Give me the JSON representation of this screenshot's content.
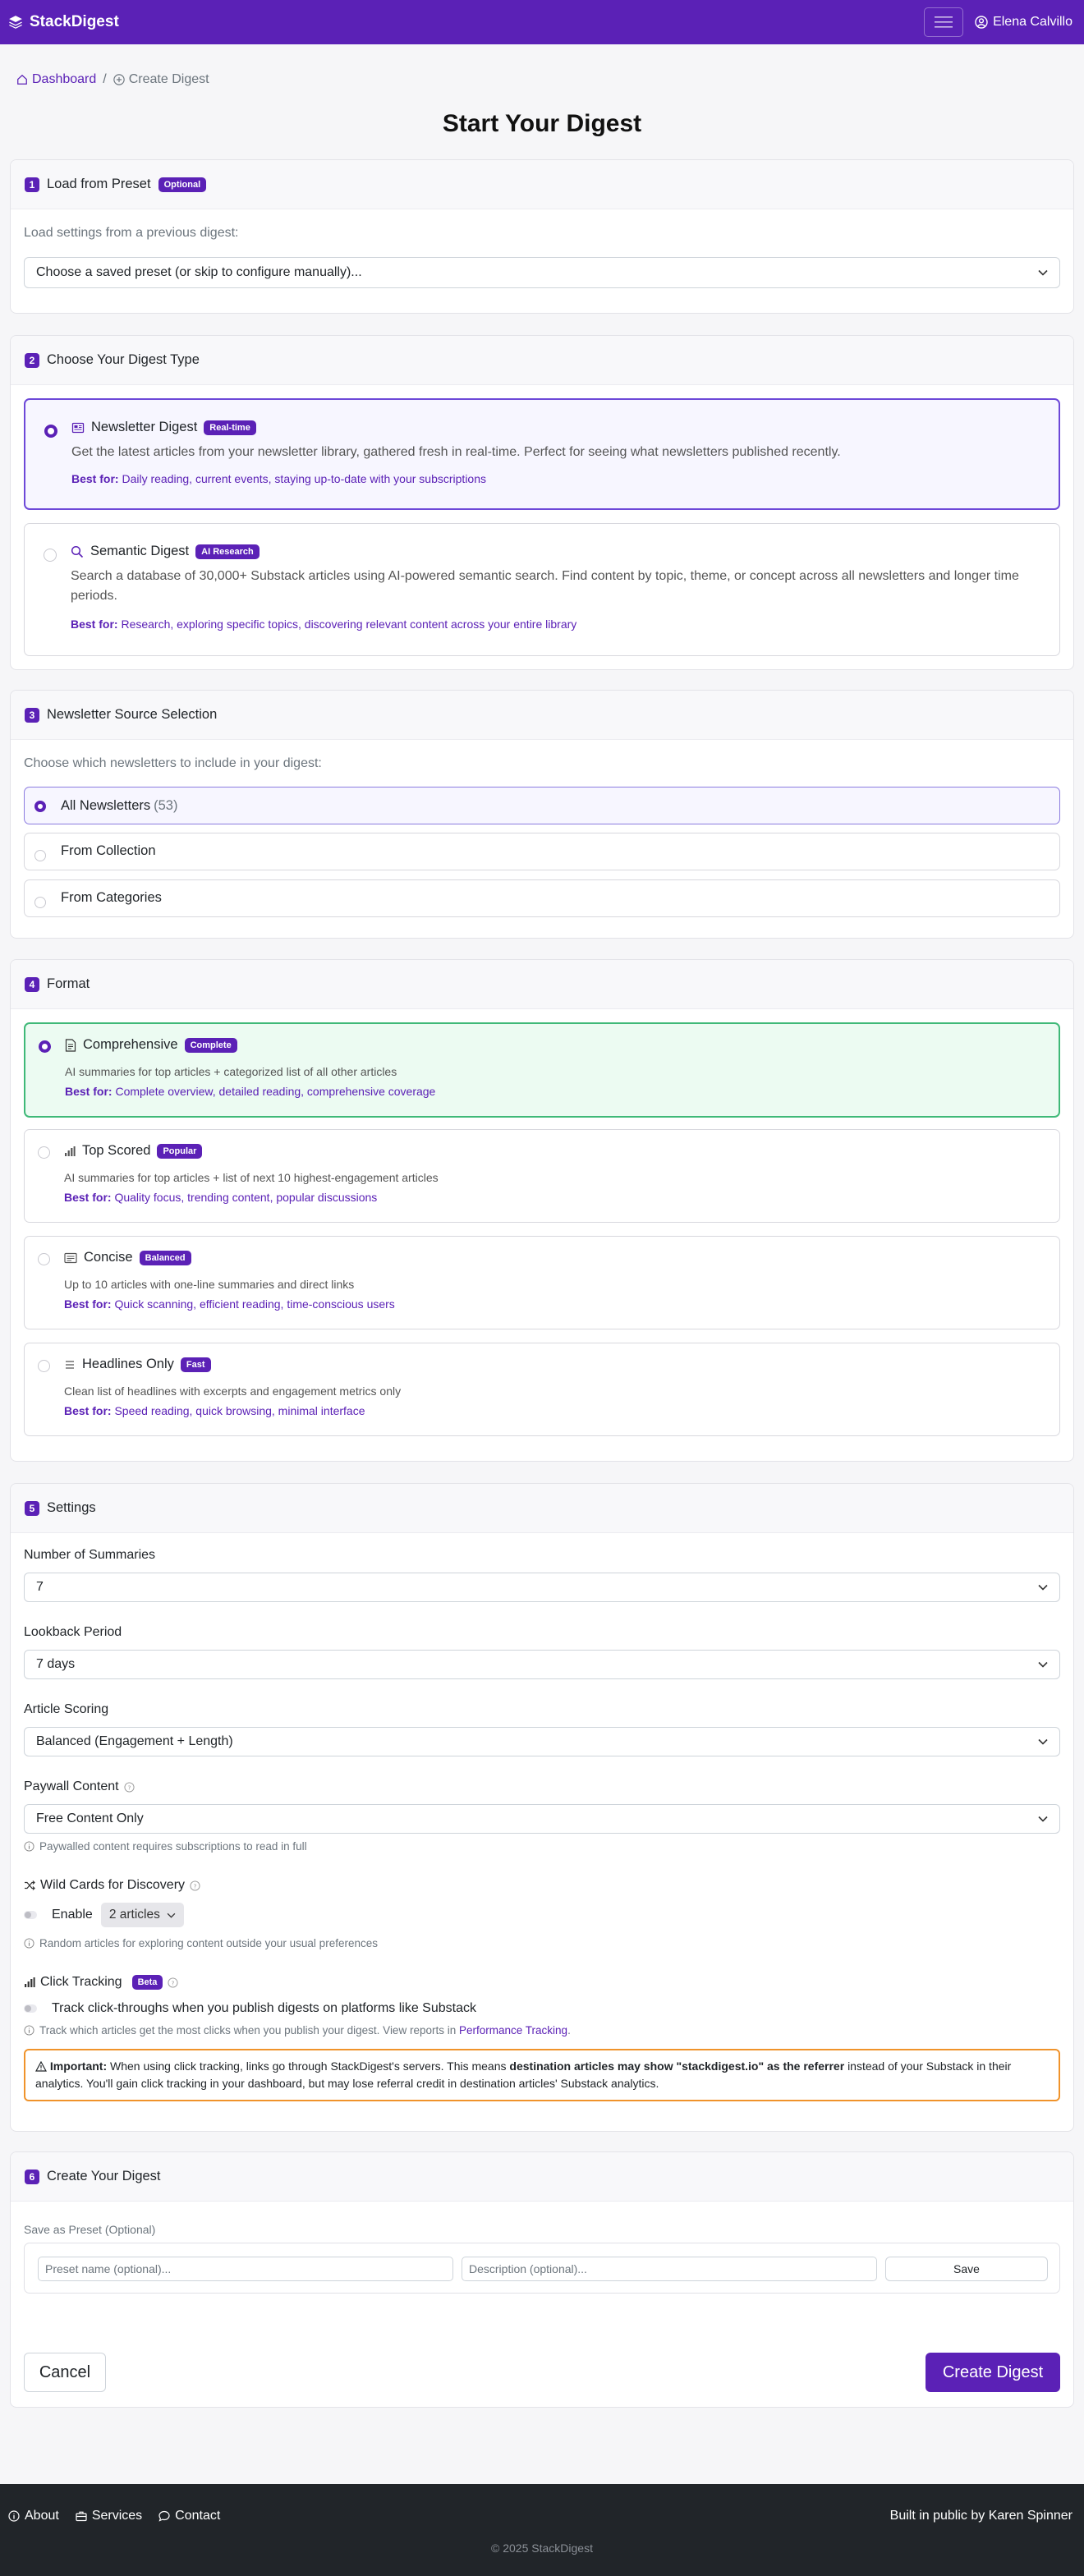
{
  "nav": {
    "brand": "StackDigest",
    "user": "Elena Calvillo"
  },
  "breadcrumb": {
    "home": "Dashboard",
    "separator": "/",
    "current": "Create Digest"
  },
  "page_title": "Start Your Digest",
  "s1": {
    "num": "1",
    "title": "Load from Preset",
    "badge": "Optional",
    "label": "Load settings from a previous digest:",
    "select": "Choose a saved preset (or skip to configure manually)..."
  },
  "s2": {
    "num": "2",
    "title": "Choose Your Digest Type",
    "types": [
      {
        "title": "Newsletter Digest",
        "badge": "Real-time",
        "desc": "Get the latest articles from your newsletter library, gathered fresh in real-time. Perfect for seeing what newsletters published recently.",
        "best_label": "Best for:",
        "best": "Daily reading, current events, staying up-to-date with your subscriptions"
      },
      {
        "title": "Semantic Digest",
        "badge": "AI Research",
        "desc": "Search a database of 30,000+ Substack articles using AI-powered semantic search. Find content by topic, theme, or concept across all newsletters and longer time periods.",
        "best_label": "Best for:",
        "best": "Research, exploring specific topics, discovering relevant content across your entire library"
      }
    ]
  },
  "s3": {
    "num": "3",
    "title": "Newsletter Source Selection",
    "label": "Choose which newsletters to include in your digest:",
    "options": [
      {
        "label": "All Newsletters",
        "count": "(53)"
      },
      {
        "label": "From Collection",
        "count": ""
      },
      {
        "label": "From Categories",
        "count": ""
      }
    ]
  },
  "s4": {
    "num": "4",
    "title": "Format",
    "formats": [
      {
        "title": "Comprehensive",
        "badge": "Complete",
        "desc": "AI summaries for top articles + categorized list of all other articles",
        "best_label": "Best for:",
        "best": "Complete overview, detailed reading, comprehensive coverage"
      },
      {
        "title": "Top Scored",
        "badge": "Popular",
        "desc": "AI summaries for top articles + list of next 10 highest-engagement articles",
        "best_label": "Best for:",
        "best": "Quality focus, trending content, popular discussions"
      },
      {
        "title": "Concise",
        "badge": "Balanced",
        "desc": "Up to 10 articles with one-line summaries and direct links",
        "best_label": "Best for:",
        "best": "Quick scanning, efficient reading, time-conscious users"
      },
      {
        "title": "Headlines Only",
        "badge": "Fast",
        "desc": "Clean list of headlines with excerpts and engagement metrics only",
        "best_label": "Best for:",
        "best": "Speed reading, quick browsing, minimal interface"
      }
    ]
  },
  "s5": {
    "num": "5",
    "title": "Settings",
    "summaries_label": "Number of Summaries",
    "summaries_value": "7",
    "lookback_label": "Lookback Period",
    "lookback_value": "7 days",
    "scoring_label": "Article Scoring",
    "scoring_value": "Balanced (Engagement + Length)",
    "paywall_label": "Paywall Content",
    "paywall_value": "Free Content Only",
    "paywall_hint": "Paywalled content requires subscriptions to read in full",
    "wild_label": "Wild Cards for Discovery",
    "wild_enable": "Enable",
    "wild_value": "2 articles",
    "wild_hint": "Random articles for exploring content outside your usual preferences",
    "track_label": "Click Tracking",
    "track_badge": "Beta",
    "track_check": "Track click-throughs when you publish digests on platforms like Substack",
    "track_hint": "Track which articles get the most clicks when you publish your digest. View reports in",
    "track_link": "Performance Tracking",
    "warn_strong": "Important:",
    "warn_1": "When using click tracking, links go through StackDigest's servers. This means",
    "warn_bold": "destination articles may show \"stackdigest.io\" as the referrer",
    "warn_2": "instead of your Substack in their analytics. You'll gain click tracking in your dashboard, but may lose referral credit in destination articles' Substack analytics."
  },
  "s6": {
    "num": "6",
    "title": "Create Your Digest",
    "preset_label": "Save as Preset (Optional)",
    "name_ph": "Preset name (optional)...",
    "desc_ph": "Description (optional)...",
    "save": "Save",
    "cancel": "Cancel",
    "create": "Create Digest"
  },
  "footer": {
    "about": "About",
    "services": "Services",
    "contact": "Contact",
    "built": "Built in public by Karen Spinner",
    "copyright": "© 2025 StackDigest"
  }
}
